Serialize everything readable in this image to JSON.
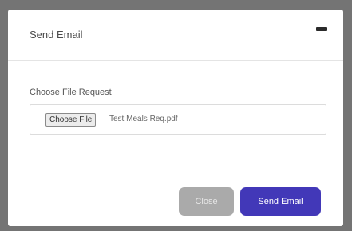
{
  "modal": {
    "title": "Send Email",
    "minimize_icon": "minimize-icon"
  },
  "form": {
    "label": "Choose File Request",
    "file_button_label": "Choose File",
    "file_name": "Test Meals Req.pdf"
  },
  "footer": {
    "close_label": "Close",
    "send_label": "Send Email"
  },
  "colors": {
    "primary": "#4238b8",
    "secondary": "#aaaaaa",
    "backdrop": "#747474"
  }
}
